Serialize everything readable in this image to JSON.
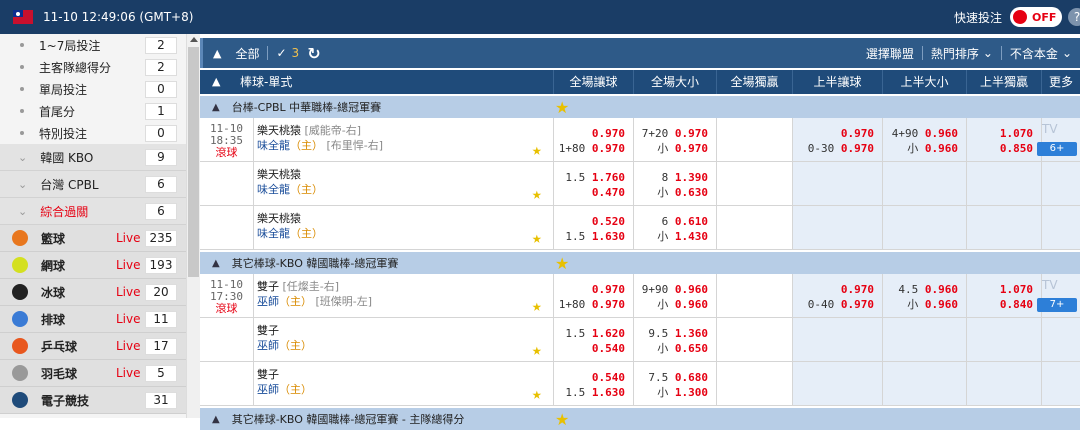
{
  "topbar": {
    "time": "11-10 12:49:06 (GMT+8)",
    "quick_bet_label": "快速投注",
    "toggle_label": "OFF",
    "help_label": "?"
  },
  "sidebar": {
    "sub_items": [
      {
        "label": "1~7局投注",
        "count": "2"
      },
      {
        "label": "主客隊總得分",
        "count": "2"
      },
      {
        "label": "單局投注",
        "count": "0"
      },
      {
        "label": "首尾分",
        "count": "1"
      },
      {
        "label": "特別投注",
        "count": "0"
      }
    ],
    "leagues": [
      {
        "label": "韓國 KBO",
        "count": "9"
      },
      {
        "label": "台灣 CPBL",
        "count": "6"
      },
      {
        "label": "綜合過關",
        "count": "6"
      }
    ],
    "sports": [
      {
        "label": "籃球",
        "live": "Live",
        "count": "235",
        "icon": "basketball-icon",
        "color": "#e8771e"
      },
      {
        "label": "網球",
        "live": "Live",
        "count": "193",
        "icon": "tennis-icon",
        "color": "#d4e020"
      },
      {
        "label": "冰球",
        "live": "Live",
        "count": "20",
        "icon": "hockey-icon",
        "color": "#222222"
      },
      {
        "label": "排球",
        "live": "Live",
        "count": "11",
        "icon": "volleyball-icon",
        "color": "#3a7bd5"
      },
      {
        "label": "乒乓球",
        "live": "Live",
        "count": "17",
        "icon": "table-tennis-icon",
        "color": "#e8571e"
      },
      {
        "label": "羽毛球",
        "live": "Live",
        "count": "5",
        "icon": "badminton-icon",
        "color": "#999999"
      },
      {
        "label": "電子競技",
        "live": "",
        "count": "31",
        "icon": "gamepad-icon",
        "color": "#1f4b7a"
      }
    ]
  },
  "toolbar": {
    "all_label": "全部",
    "count": "3",
    "select_league": "選擇聯盟",
    "hot_sort": "熱門排序",
    "exclude_principal": "不含本金"
  },
  "header": {
    "sport": "棒球-單式",
    "cols": [
      "全場讓球",
      "全場大小",
      "全場獨贏",
      "上半讓球",
      "上半大小",
      "上半獨贏",
      "更多"
    ]
  },
  "leagues": [
    {
      "title": "台棒-CPBL 中華職棒-總冠軍賽"
    },
    {
      "title": "其它棒球-KBO 韓國職棒-總冠軍賽"
    },
    {
      "title": "其它棒球-KBO 韓國職棒-總冠軍賽 - 主隊總得分"
    }
  ],
  "matches": [
    {
      "date": "11-10",
      "time": "18:35",
      "status": "滾球",
      "away": "樂天桃猿",
      "away_pitcher": "[威能帝-右]",
      "home": "味全龍",
      "home_tag": "（主）",
      "home_pitcher": "[布里悍-右]",
      "hdp_top_h": "",
      "hdp_top": "0.970",
      "hdp_bot_h": "1+80",
      "hdp_bot": "0.970",
      "ou_top_h": "7+20",
      "ou_top": "0.970",
      "ou_bot_h": "小",
      "ou_bot": "0.970",
      "h1hdp_top_h": "",
      "h1hdp_top": "0.970",
      "h1hdp_bot_h": "0-30",
      "h1hdp_bot": "0.970",
      "h1ou_top_h": "4+90",
      "h1ou_top": "0.960",
      "h1ou_bot_h": "小",
      "h1ou_bot": "0.960",
      "h1ml_top": "1.070",
      "h1ml_bot": "0.850",
      "tv": "TV",
      "more": "6+"
    },
    {
      "away": "樂天桃猿",
      "home": "味全龍",
      "home_tag": "（主）",
      "hdp_top_h": "1.5",
      "hdp_top": "1.760",
      "hdp_bot_h": "",
      "hdp_bot": "0.470",
      "ou_top_h": "8",
      "ou_top": "1.390",
      "ou_bot_h": "小",
      "ou_bot": "0.630"
    },
    {
      "away": "樂天桃猿",
      "home": "味全龍",
      "home_tag": "（主）",
      "hdp_top_h": "",
      "hdp_top": "0.520",
      "hdp_bot_h": "1.5",
      "hdp_bot": "1.630",
      "ou_top_h": "6",
      "ou_top": "0.610",
      "ou_bot_h": "小",
      "ou_bot": "1.430"
    },
    {
      "date": "11-10",
      "time": "17:30",
      "status": "滾球",
      "away": "雙子",
      "away_pitcher": "[任燦圭-右]",
      "home": "巫師",
      "home_tag": "（主）",
      "home_pitcher": "[班傑明-左]",
      "hdp_top_h": "",
      "hdp_top": "0.970",
      "hdp_bot_h": "1+80",
      "hdp_bot": "0.970",
      "ou_top_h": "9+90",
      "ou_top": "0.960",
      "ou_bot_h": "小",
      "ou_bot": "0.960",
      "h1hdp_top_h": "",
      "h1hdp_top": "0.970",
      "h1hdp_bot_h": "0-40",
      "h1hdp_bot": "0.970",
      "h1ou_top_h": "4.5",
      "h1ou_top": "0.960",
      "h1ou_bot_h": "小",
      "h1ou_bot": "0.960",
      "h1ml_top": "1.070",
      "h1ml_bot": "0.840",
      "tv": "TV",
      "more": "7+"
    },
    {
      "away": "雙子",
      "home": "巫師",
      "home_tag": "（主）",
      "hdp_top_h": "1.5",
      "hdp_top": "1.620",
      "hdp_bot_h": "",
      "hdp_bot": "0.540",
      "ou_top_h": "9.5",
      "ou_top": "1.360",
      "ou_bot_h": "小",
      "ou_bot": "0.650"
    },
    {
      "away": "雙子",
      "home": "巫師",
      "home_tag": "（主）",
      "hdp_top_h": "",
      "hdp_top": "0.540",
      "hdp_bot_h": "1.5",
      "hdp_bot": "1.630",
      "ou_top_h": "7.5",
      "ou_top": "0.680",
      "ou_bot_h": "小",
      "ou_bot": "1.300"
    }
  ]
}
